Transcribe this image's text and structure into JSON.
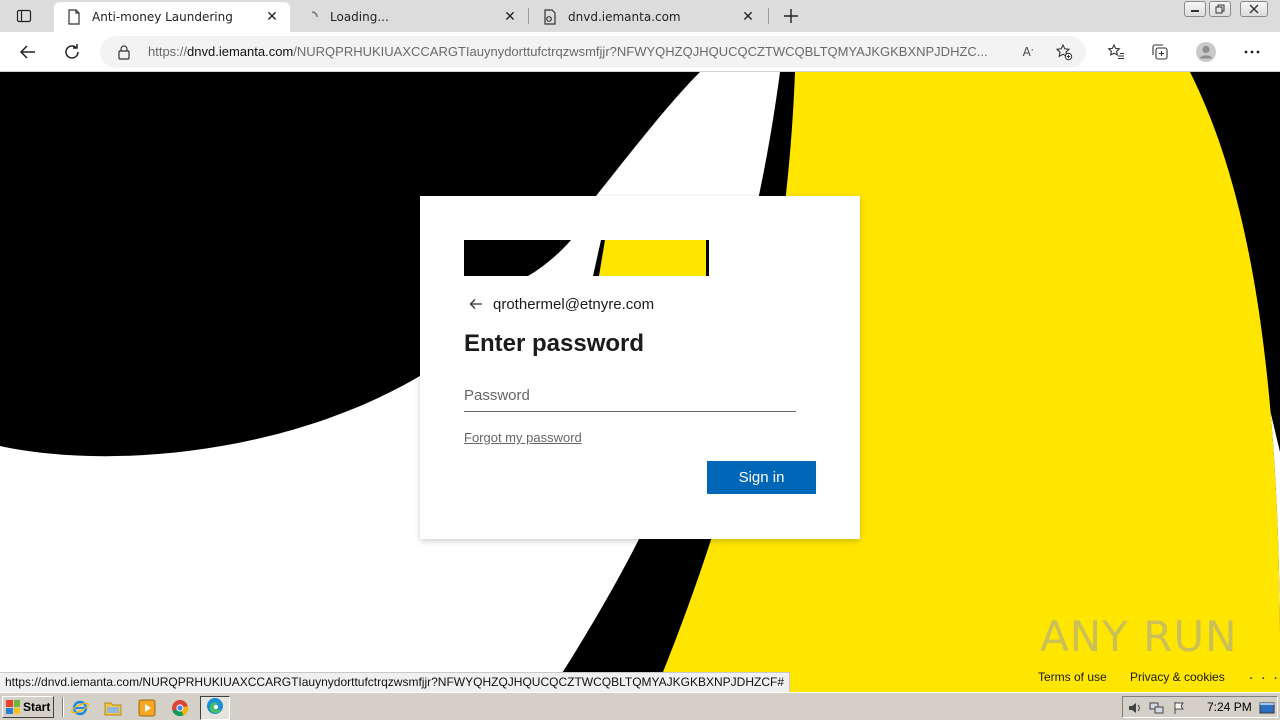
{
  "browser": {
    "tabs": [
      {
        "title": "Anti-money Laundering",
        "icon": "page-icon",
        "active": true
      },
      {
        "title": "Loading...",
        "icon": "loading-icon",
        "active": false
      },
      {
        "title": "dnvd.iemanta.com",
        "icon": "page-gear-icon",
        "active": false
      }
    ],
    "address": {
      "prefix": "https://",
      "host": "dnvd.iemanta.com",
      "path": "/NURQPRHUKIUAXCCARGTIauynydorttufctrqzwsmfjjr?NFWYQHZQJHQUCQCZTWCQBLTQMYAJKGKBXNPJDHZC..."
    },
    "status_url": "https://dnvd.iemanta.com/NURQPRHUKIUAXCCARGTIauynydorttufctrqzwsmfjjr?NFWYQHZQJHQUCQCZTWCQBLTQMYAJKGKBXNPJDHZCF#"
  },
  "login": {
    "email": "qrothermel@etnyre.com",
    "heading": "Enter password",
    "password_placeholder": "Password",
    "forgot_label": "Forgot my password",
    "signin_label": "Sign in"
  },
  "footer": {
    "terms": "Terms of use",
    "privacy": "Privacy & cookies",
    "more": ". . ."
  },
  "watermark": "ANY RUN",
  "taskbar": {
    "start_label": "Start",
    "clock": "7:24 PM"
  },
  "colors": {
    "brand_yellow": "#ffe600",
    "brand_black": "#000000",
    "signin_blue": "#0067b8"
  }
}
